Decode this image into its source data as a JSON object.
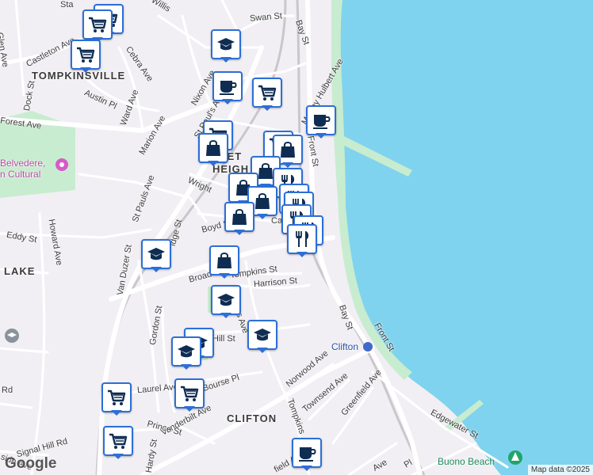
{
  "map": {
    "water_color": "#7fd3ee",
    "land_color": "#f1eff4",
    "park_color": "#c8eccf",
    "pin_color": "#2c6fd6",
    "icon_color": "#0f2d52"
  },
  "streets": {
    "glen": "Glen Ave",
    "castleton": "Castleton Ave",
    "cebra": "Cebra Ave",
    "ward": "Ward Ave",
    "austin": "Austin Pl",
    "dock": "Dock St",
    "forest": "Forest Ave",
    "marion": "Marion Ave",
    "nixon": "Nixon Ave",
    "st_pauls_1": "St Paul's Ave",
    "st_pauls_2": "St Pauls Ave",
    "van_duzer": "Van Duzer St",
    "howard": "Howard Ave",
    "eddy": "Eddy St",
    "swan": "Swan St",
    "willis": "Willis",
    "bay_1": "Bay St",
    "bay_2": "Bay St",
    "murray": "Murray Hulbert Ave",
    "front_1": "Front St",
    "front_2": "Front St",
    "boyd": "Boyd St",
    "canal": "Canal St",
    "wright": "Wright",
    "broad": "Broad",
    "tompkins_1": "Tompkins St",
    "tompkins_2": "Tompkins",
    "harrison": "Harrison St",
    "hill": "Hill St",
    "gordon": "Gordon St",
    "norwood": "Norwood Ave",
    "townsend": "Townsend Ave",
    "greenfield": "Greenfield Ave",
    "laurel": "Laurel Ave",
    "bourse": "Bourse Pl",
    "vanderbilt": "Vanderbilt Ave",
    "prince": "Prince St",
    "hardy": "Hardy St",
    "signal": "Signal Hill Rd",
    "edgewater": "Edgewater St",
    "stapleton": "Sta",
    "hill_rd": "Rd",
    "side": "side Ave",
    "field": "field Ave",
    "pl": "Pl",
    "ave": "Ave",
    "idge": "idge St",
    "ws": "s Ave"
  },
  "areas": {
    "tompkinsville": "TOMPKINSVILLE",
    "stapleton_heights_1": "PLET",
    "stapleton_heights_2": "HEIGH",
    "lake": "LAKE",
    "clifton": "CLIFTON"
  },
  "places": {
    "belvedere": "Belvedere,",
    "cultural": "n Cultural",
    "clifton_station": "Clifton",
    "buono_beach": "Buono Beach"
  },
  "attribution": "Map data ©2025",
  "google_logo": "Google"
}
